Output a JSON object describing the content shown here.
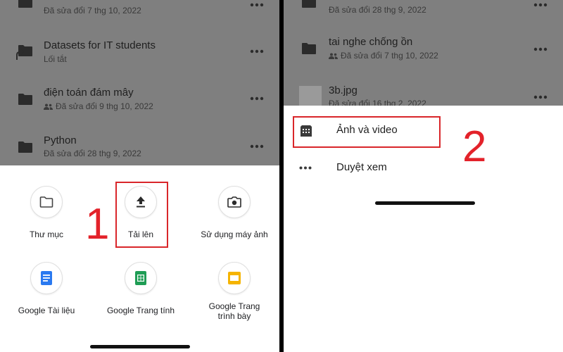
{
  "left_panel": {
    "files": [
      {
        "name": "",
        "sub": "Đã sửa đổi 7 thg 10, 2022",
        "shared": false
      },
      {
        "name": "Datasets for IT students",
        "sub": "Lối tắt",
        "shared": false
      },
      {
        "name": "điện toán đám mây",
        "sub": "Đã sửa đổi 9 thg 10, 2022",
        "shared": true
      },
      {
        "name": "Python",
        "sub": "Đã sửa đổi 28 thg 9, 2022",
        "shared": false
      }
    ],
    "create_menu": [
      {
        "label": "Thư mục",
        "icon": "folder-icon"
      },
      {
        "label": "Tải lên",
        "icon": "upload-icon"
      },
      {
        "label": "Sử dụng máy ảnh",
        "icon": "camera-icon"
      },
      {
        "label": "Google Tài liệu",
        "icon": "google-docs-icon"
      },
      {
        "label": "Google Trang tính",
        "icon": "google-sheets-icon"
      },
      {
        "label": "Google Trang trình bày",
        "icon": "google-slides-icon"
      }
    ],
    "step_number": "1"
  },
  "right_panel": {
    "files": [
      {
        "name": "",
        "sub": "Đã sửa đổi 28 thg 9, 2022",
        "shared": false
      },
      {
        "name": "tai nghe chống ồn",
        "sub": "Đã sửa đổi 7 thg 10, 2022",
        "shared": true
      },
      {
        "name": "3b.jpg",
        "sub": "Đã sửa đổi 16 thg 2, 2022",
        "shared": false
      }
    ],
    "upload_menu": [
      {
        "label": "Ảnh và video",
        "icon": "photos-icon"
      },
      {
        "label": "Duyệt xem",
        "icon": "more-horizontal-icon"
      }
    ],
    "step_number": "2"
  },
  "colors": {
    "highlight_red": "#d9262a",
    "docs_blue": "#2a79f0",
    "sheets_green": "#1f9d55",
    "slides_yellow": "#f5b400",
    "dim_overlay": "#7f7f7f"
  }
}
